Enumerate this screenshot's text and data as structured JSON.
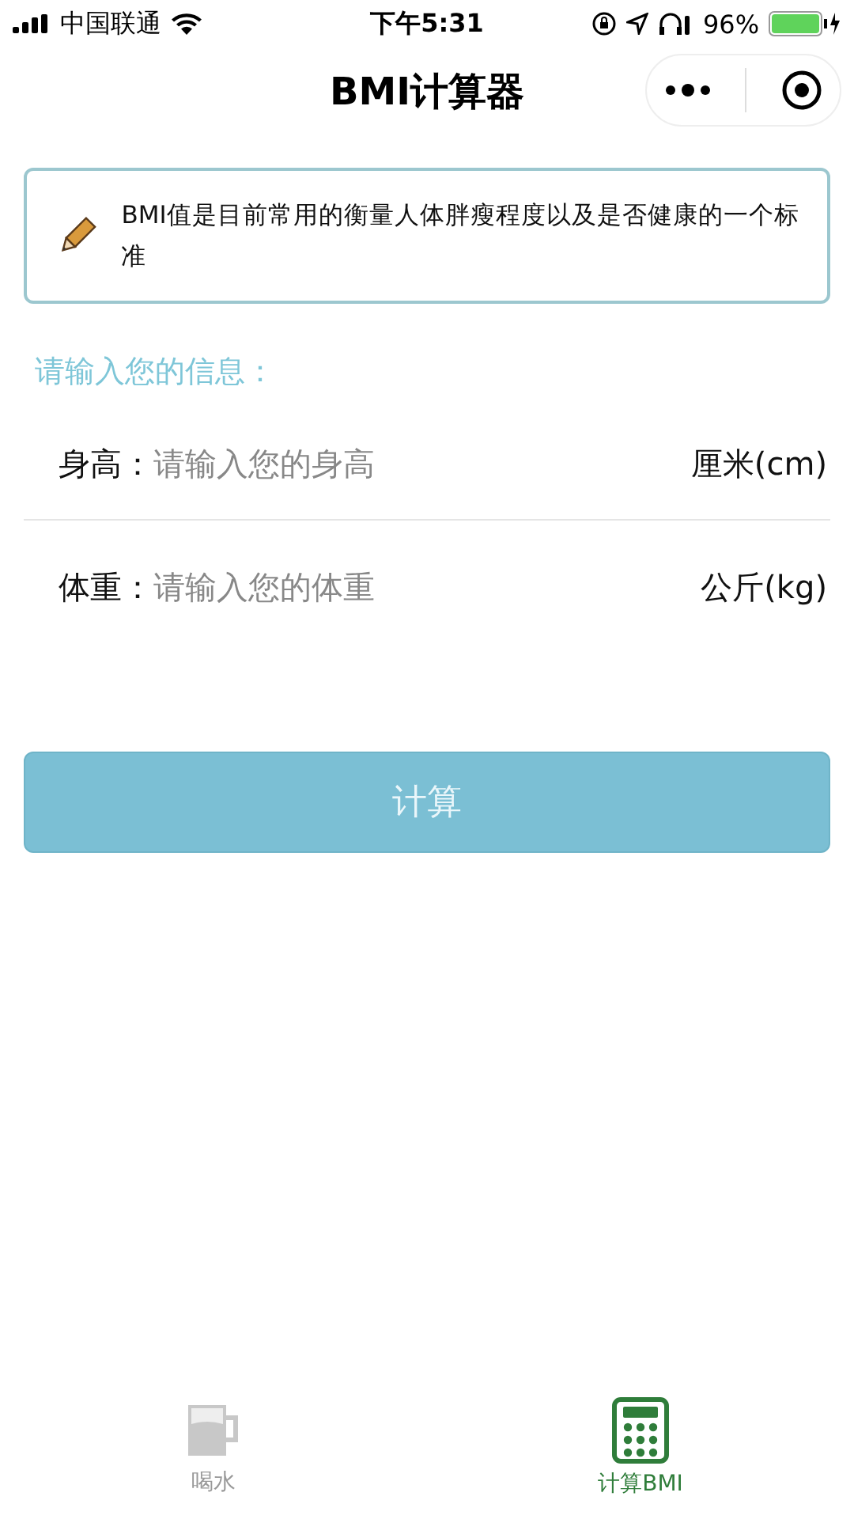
{
  "status_bar": {
    "carrier": "中国联通",
    "time": "下午5:31",
    "battery": "96%"
  },
  "nav": {
    "title": "BMI计算器"
  },
  "notice": {
    "text": "BMI值是目前常用的衡量人体胖瘦程度以及是否健康的一个标准"
  },
  "form": {
    "heading": "请输入您的信息：",
    "fields": [
      {
        "label": "身高：",
        "placeholder": "请输入您的身高",
        "unit": "厘米(cm)"
      },
      {
        "label": "体重：",
        "placeholder": "请输入您的体重",
        "unit": "公斤(kg)"
      }
    ]
  },
  "button": "计算",
  "tabs": [
    {
      "kind": "cup",
      "label": "喝水",
      "selected": false
    },
    {
      "kind": "calculator",
      "label": "计算BMI",
      "selected": true
    }
  ]
}
